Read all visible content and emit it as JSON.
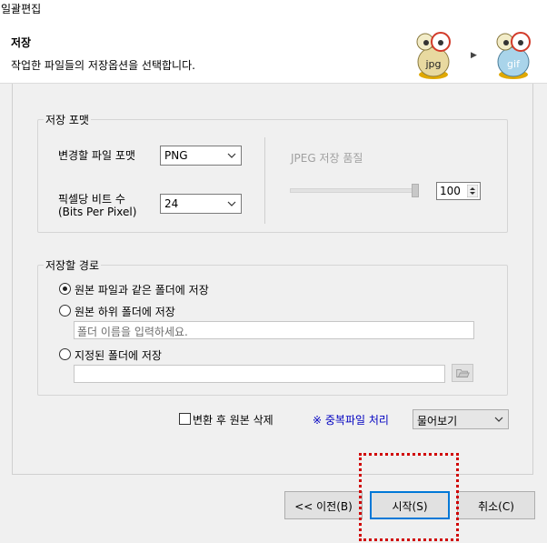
{
  "window": {
    "title": "일괄편집"
  },
  "header": {
    "title": "저장",
    "description": "작업한 파일들의 저장옵션을 선택합니다.",
    "from_format": "jpg",
    "to_format": "gif",
    "arrow_icon": "arrow-right-icon"
  },
  "format_group": {
    "legend": "저장 포맷",
    "format_label": "변경할 파일 포맷",
    "format_value": "PNG",
    "bits_label_line1": "픽셀당 비트 수",
    "bits_label_line2": "(Bits Per Pixel)",
    "bits_value": "24",
    "jpeg_label": "JPEG 저장 품질",
    "jpeg_quality": "100",
    "jpeg_quality_level": 1.0
  },
  "path_group": {
    "legend": "저장할 경로",
    "options": [
      {
        "label": "원본 파일과 같은 폴더에 저장",
        "selected": true
      },
      {
        "label": "원본 하위 폴더에 저장",
        "selected": false
      },
      {
        "label": "지정된 폴더에 저장",
        "selected": false
      }
    ],
    "subfolder_placeholder": "폴더 이름을 입력하세요.",
    "custom_folder_value": ""
  },
  "options_row": {
    "delete_original_label": "변환 후 원본 삭제",
    "delete_original_checked": false,
    "duplicate_link": "※ 중복파일 처리",
    "duplicate_value": "물어보기"
  },
  "buttons": {
    "prev": "<< 이전(B)",
    "start": "시작(S)",
    "cancel": "취소(C)"
  },
  "colors": {
    "accent": "#0078d7",
    "link": "#0000c0",
    "highlight": "#d00000"
  }
}
